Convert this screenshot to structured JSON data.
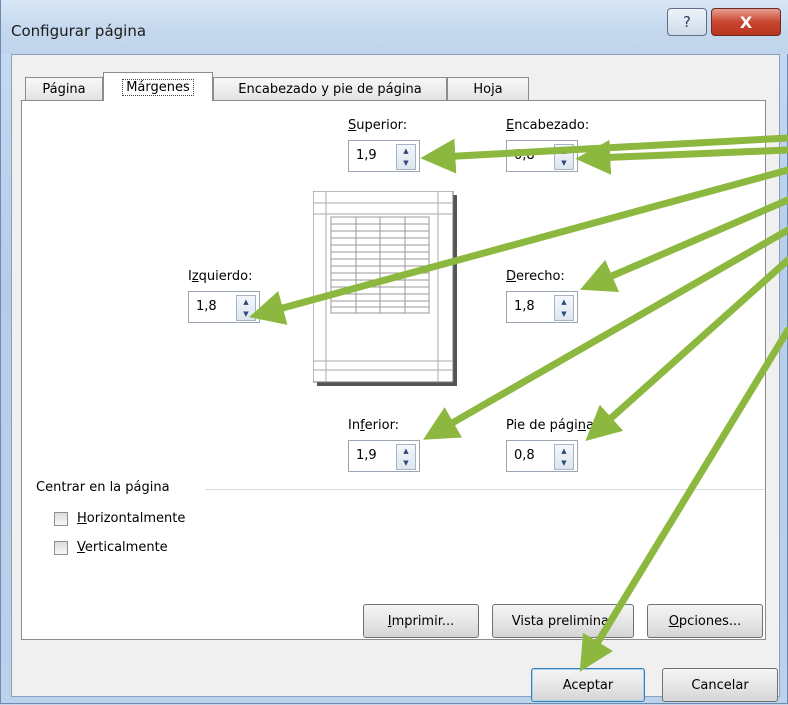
{
  "window": {
    "title": "Configurar página",
    "help_glyph": "?",
    "close_glyph": "X"
  },
  "tabs": [
    {
      "label": "Página"
    },
    {
      "label": "Márgenes",
      "active": true
    },
    {
      "label": "Encabezado y pie de página"
    },
    {
      "label": "Hoja"
    }
  ],
  "margins": {
    "superior": {
      "label_first": "S",
      "label_rest": "uperior:",
      "value": "1,9"
    },
    "encabezado": {
      "label_first": "E",
      "label_rest": "ncabezado:",
      "value": "0,8"
    },
    "izquierdo": {
      "label_pre": "I",
      "label_u": "z",
      "label_rest": "quierdo:",
      "value": "1,8"
    },
    "derecho": {
      "label_first": "D",
      "label_rest": "erecho:",
      "value": "1,8"
    },
    "inferior": {
      "label_pre": "In",
      "label_u": "f",
      "label_rest": "erior:",
      "value": "1,9"
    },
    "pie": {
      "label_pre": "Pie de pági",
      "label_u": "n",
      "label_rest": "a:",
      "value": "0,8"
    }
  },
  "center": {
    "section_label": "Centrar en la página",
    "horizontal": {
      "first": "H",
      "rest": "orizontalmente",
      "checked": false
    },
    "vertical": {
      "first": "V",
      "rest": "erticalmente",
      "checked": false
    }
  },
  "buttons": {
    "imprimir": {
      "first": "I",
      "rest": "mprimir..."
    },
    "vista": {
      "label": "Vista preliminar"
    },
    "opciones": {
      "first": "O",
      "rest": "pciones..."
    },
    "aceptar": {
      "label": "Aceptar"
    },
    "cancelar": {
      "label": "Cancelar"
    }
  },
  "icons": {
    "spin_up": "▲",
    "spin_down": "▼",
    "arrow_color": "#8db83f"
  }
}
